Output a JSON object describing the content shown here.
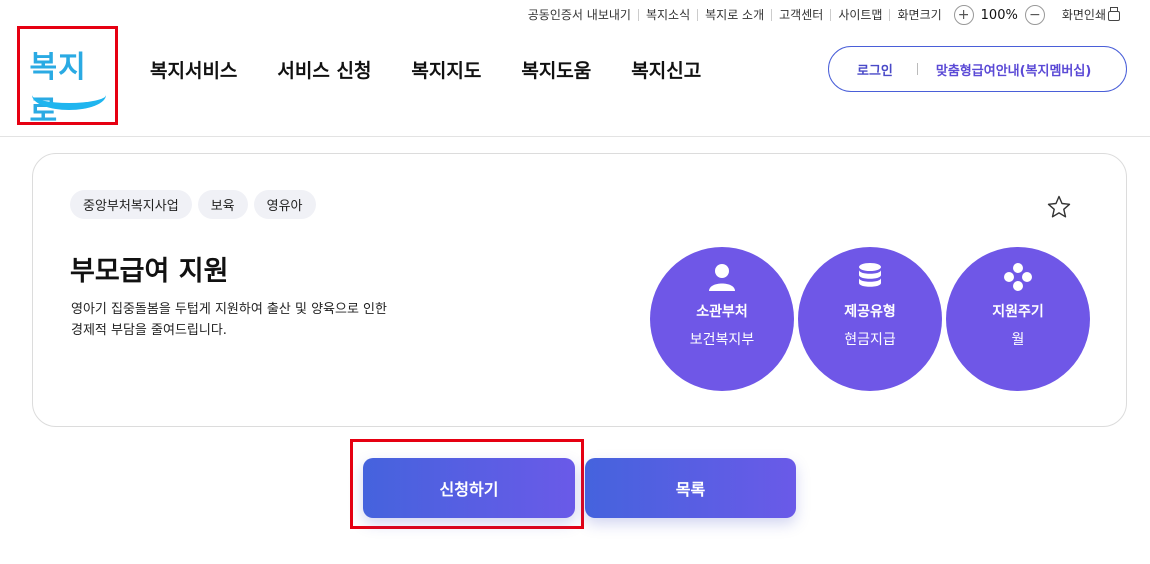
{
  "utility": {
    "items": [
      "공동인증서 내보내기",
      "복지소식",
      "복지로 소개",
      "고객센터",
      "사이트맵",
      "화면크기"
    ],
    "zoom_in": "+",
    "zoom_value": "100%",
    "zoom_out": "−",
    "print_label": "화면인쇄"
  },
  "logo": {
    "text": "복지로"
  },
  "nav": {
    "items": [
      "복지서비스",
      "서비스 신청",
      "복지지도",
      "복지도움",
      "복지신고"
    ]
  },
  "account": {
    "login": "로그인",
    "membership": "맞춤형급여안내(복지멤버십)"
  },
  "service": {
    "tags": [
      "중앙부처복지사업",
      "보육",
      "영유아"
    ],
    "title": "부모급여 지원",
    "description_line1": "영아기 집중돌봄을 두텁게 지원하여 출산 및 양육으로 인한",
    "description_line2": "경제적 부담을 줄여드립니다.",
    "info": [
      {
        "icon": "person-icon",
        "label": "소관부처",
        "value": "보건복지부"
      },
      {
        "icon": "database-icon",
        "label": "제공유형",
        "value": "현금지급"
      },
      {
        "icon": "cycle-icon",
        "label": "지원주기",
        "value": "월"
      }
    ]
  },
  "actions": {
    "apply": "신청하기",
    "list": "목록"
  },
  "colors": {
    "accent": "#6f57e7",
    "button_start": "#4563dd",
    "button_end": "#6a5ae8",
    "highlight": "#e60012",
    "logo": "#2aaae3"
  }
}
